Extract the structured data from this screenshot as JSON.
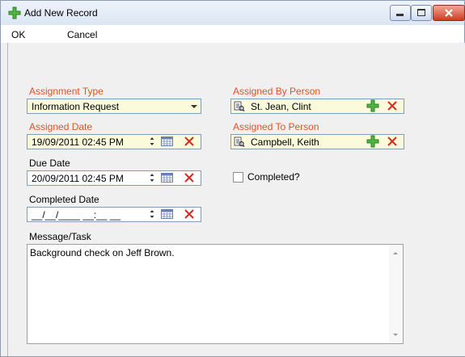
{
  "window": {
    "title": "Add New Record",
    "icons": {
      "app": "plus-icon",
      "minimize": "minimize-icon",
      "maximize": "maximize-icon",
      "close": "close-icon"
    }
  },
  "menu": {
    "ok": "OK",
    "cancel": "Cancel"
  },
  "form": {
    "assignment_type": {
      "label": "Assignment Type",
      "value": "Information Request"
    },
    "assigned_date": {
      "label": "Assigned Date",
      "value": "19/09/2011 02:45 PM"
    },
    "due_date": {
      "label": "Due Date",
      "value": "20/09/2011 02:45 PM"
    },
    "completed_date": {
      "label": "Completed Date",
      "value": "__/__/____ __:__ __"
    },
    "assigned_by": {
      "label": "Assigned By Person",
      "value": "St. Jean, Clint"
    },
    "assigned_to": {
      "label": "Assigned To Person",
      "value": "Campbell, Keith"
    },
    "completed": {
      "label": "Completed?",
      "checked": false
    },
    "message": {
      "label": "Message/Task",
      "value": "Background check on Jeff Brown."
    }
  },
  "colors": {
    "required_label": "#e05224",
    "highlight_field": "#fbfbdc",
    "delete_x": "#d42b1e",
    "add_plus": "#3c9a2f"
  }
}
